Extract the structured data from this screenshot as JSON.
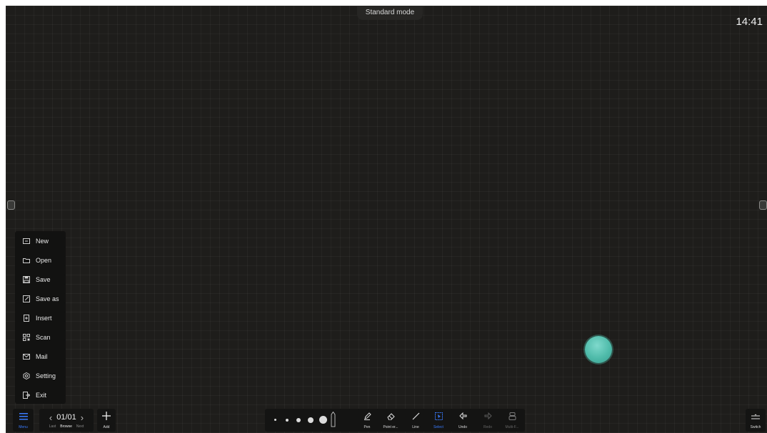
{
  "header": {
    "mode": "Standard mode",
    "clock": "14:41"
  },
  "menu": {
    "items": [
      {
        "label": "New",
        "icon": "new-file-icon"
      },
      {
        "label": "Open",
        "icon": "open-folder-icon"
      },
      {
        "label": "Save",
        "icon": "save-icon"
      },
      {
        "label": "Save as",
        "icon": "save-as-icon"
      },
      {
        "label": "Insert",
        "icon": "insert-icon"
      },
      {
        "label": "Scan",
        "icon": "qr-scan-icon"
      },
      {
        "label": "Mail",
        "icon": "mail-icon"
      },
      {
        "label": "Setting",
        "icon": "gear-icon"
      },
      {
        "label": "Exit",
        "icon": "exit-icon"
      }
    ]
  },
  "toolbar": {
    "menu_label": "Menu",
    "page_counter": "01/01",
    "last_label": "Last",
    "browse_label": "Browse",
    "next_label": "Next",
    "add_label": "Add",
    "pen_label": "Pen",
    "eraser_label": "Point er...",
    "line_label": "Line",
    "select_label": "Select",
    "undo_label": "Undo",
    "redo_label": "Redo",
    "multi_label": "Multi-F...",
    "switch_label": "Switch"
  },
  "colors": {
    "accent": "#3a7bff",
    "fab": "#4fbbaa",
    "canvas": "#1e1d1b"
  }
}
